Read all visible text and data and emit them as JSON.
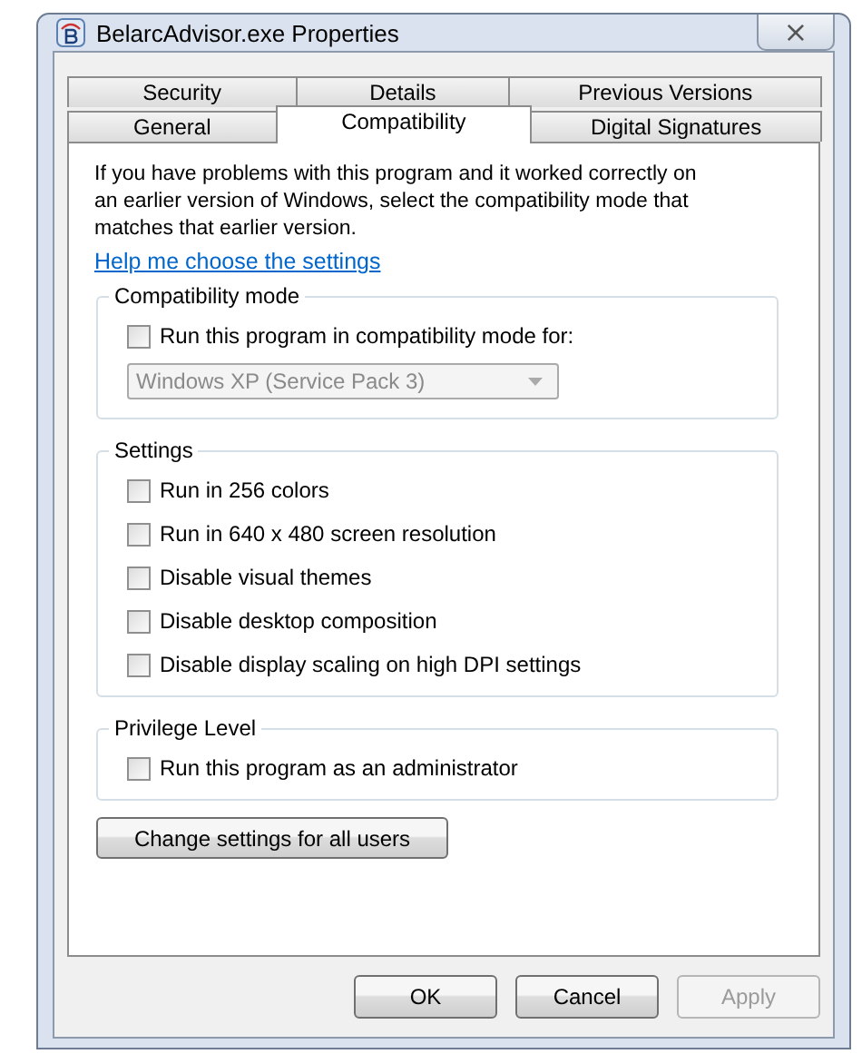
{
  "window": {
    "title": "BelarcAdvisor.exe Properties",
    "close_glyph": "×"
  },
  "tab_rows": [
    [
      {
        "label": "Security",
        "selected": false
      },
      {
        "label": "Details",
        "selected": false
      },
      {
        "label": "Previous Versions",
        "selected": false
      }
    ],
    [
      {
        "label": "General",
        "selected": false
      },
      {
        "label": "Compatibility",
        "selected": true
      },
      {
        "label": "Digital Signatures",
        "selected": false
      }
    ]
  ],
  "intro": "If you have problems with this program and it worked correctly on an earlier version of Windows, select the compatibility mode that matches that earlier version.",
  "help_link": "Help me choose the settings",
  "groups": [
    {
      "title": "Compatibility mode",
      "options": [
        {
          "label": "Run this program in compatibility mode for:",
          "checked": false
        }
      ],
      "dropdown": {
        "value": "Windows XP (Service Pack 3)",
        "disabled": true
      }
    },
    {
      "title": "Settings",
      "options": [
        {
          "label": "Run in 256 colors",
          "checked": false
        },
        {
          "label": "Run in 640 x 480 screen resolution",
          "checked": false
        },
        {
          "label": "Disable visual themes",
          "checked": false
        },
        {
          "label": "Disable desktop composition",
          "checked": false
        },
        {
          "label": "Disable display scaling on high DPI settings",
          "checked": false
        }
      ]
    },
    {
      "title": "Privilege Level",
      "options": [
        {
          "label": "Run this program as an administrator",
          "checked": false
        }
      ]
    }
  ],
  "all_users_button": "Change settings for all users",
  "buttons": [
    {
      "label": "OK",
      "disabled": false
    },
    {
      "label": "Cancel",
      "disabled": false
    },
    {
      "label": "Apply",
      "disabled": true
    }
  ]
}
